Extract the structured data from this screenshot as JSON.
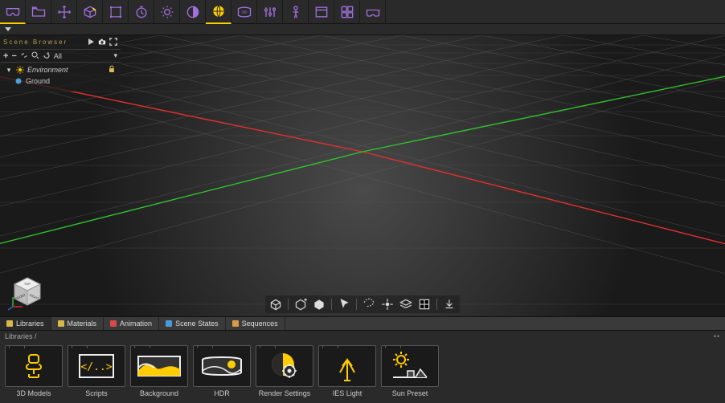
{
  "colors": {
    "accent_yellow": "#ffcc00",
    "accent_purple": "#a070e0",
    "axis_x": "#e03030",
    "axis_z": "#30c030"
  },
  "top_toolbar": [
    {
      "name": "vr-headset-icon",
      "active": true
    },
    {
      "name": "open-folder-icon",
      "active": false
    },
    {
      "name": "move-icon",
      "active": false
    },
    {
      "name": "box-edit-icon",
      "active": false
    },
    {
      "name": "bounding-box-icon",
      "active": false
    },
    {
      "name": "timer-icon",
      "active": false
    },
    {
      "name": "sun-icon",
      "active": false
    },
    {
      "name": "contrast-icon",
      "active": false
    },
    {
      "name": "globe-icon",
      "active": true
    },
    {
      "name": "panorama-360-icon",
      "active": false
    },
    {
      "name": "sliders-icon",
      "active": false
    },
    {
      "name": "mannequin-icon",
      "active": false
    },
    {
      "name": "window-icon",
      "active": false
    },
    {
      "name": "grid-layout-icon",
      "active": false
    },
    {
      "name": "headset-outline-icon",
      "active": false
    }
  ],
  "scene_browser": {
    "title": "Scene Browser",
    "filter_label": "All",
    "tree": [
      {
        "name": "Environment",
        "icon": "sun",
        "locked": true
      },
      {
        "name": "Ground",
        "icon": "sphere",
        "locked": false
      }
    ]
  },
  "viewport_toolbar": [
    "cube-wire-icon",
    "cube-add-icon",
    "cube-shaded-icon",
    "cursor-icon",
    "lasso-icon",
    "snap-icon",
    "layers-icon",
    "grid-toggle-icon",
    "download-icon"
  ],
  "view_cube": {
    "faces": [
      "TOP",
      "FRONT",
      "RIGHT"
    ]
  },
  "bottom_tabs": [
    {
      "label": "Libraries",
      "color": "#d8b84a",
      "active": true
    },
    {
      "label": "Materials",
      "color": "#d8b84a",
      "active": false
    },
    {
      "label": "Animation",
      "color": "#d84a4a",
      "active": false
    },
    {
      "label": "Scene States",
      "color": "#4a9ad8",
      "active": false
    },
    {
      "label": "Sequences",
      "color": "#d89a4a",
      "active": false
    }
  ],
  "breadcrumb": "Libraries  /",
  "library_items": [
    {
      "label": "3D Models",
      "icon": "chair"
    },
    {
      "label": "Scripts",
      "icon": "code"
    },
    {
      "label": "Background",
      "icon": "landscape"
    },
    {
      "label": "HDR",
      "icon": "hdr"
    },
    {
      "label": "Render Settings",
      "icon": "gear-sphere"
    },
    {
      "label": "IES Light",
      "icon": "ies"
    },
    {
      "label": "Sun Preset",
      "icon": "sun-preset"
    }
  ]
}
